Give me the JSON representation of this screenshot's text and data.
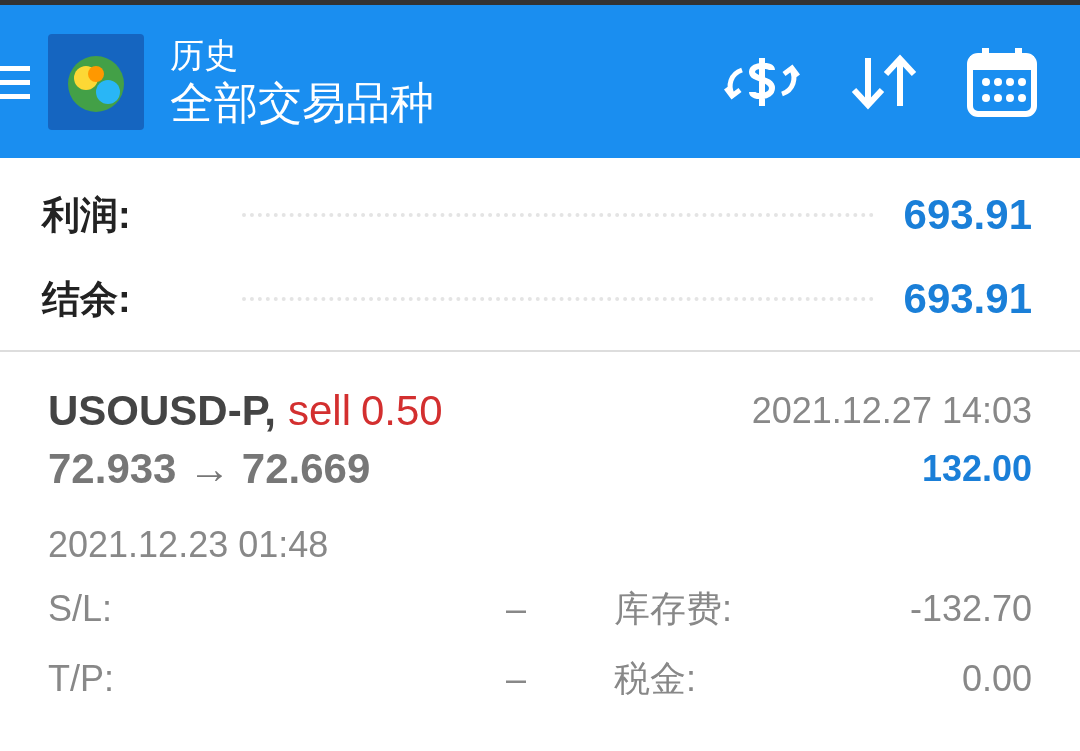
{
  "header": {
    "title": "历史",
    "subtitle": "全部交易品种"
  },
  "summary": [
    {
      "label": "利润:",
      "value": "693.91"
    },
    {
      "label": "结余:",
      "value": "693.91"
    }
  ],
  "trades": [
    {
      "symbol": "USOUSD-P,",
      "side": "sell",
      "volume": "0.50",
      "close_time": "2021.12.27 14:03",
      "prices": "72.933 → 72.669",
      "profit": "132.00",
      "open_time": "2021.12.23 01:48",
      "details": [
        {
          "label": "S/L:",
          "value": "–",
          "label2": "库存费:",
          "value2": "-132.70"
        },
        {
          "label": "T/P:",
          "value": "–",
          "label2": "税金:",
          "value2": "0.00"
        }
      ]
    }
  ]
}
